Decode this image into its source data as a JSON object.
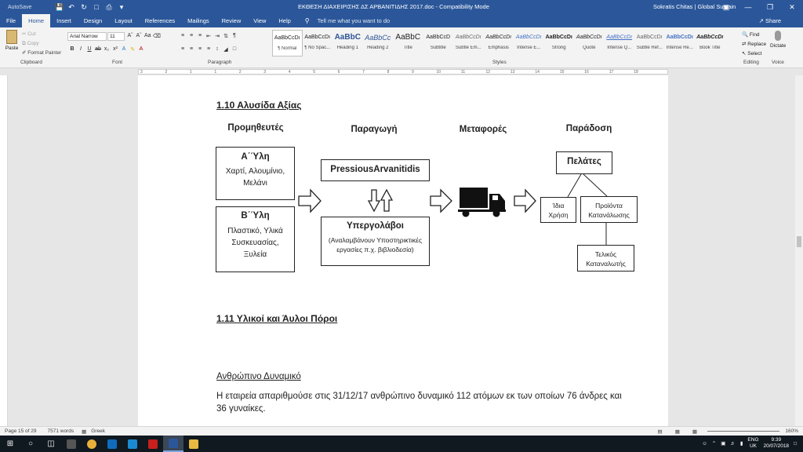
{
  "titlebar": {
    "autosave": "AutoSave",
    "doc_title": "ΕΚΘΕΣΗ ΔΙΑΧΕΙΡΙΣΗΣ ΔΣ ΑΡΒΑΝΙΤΙΔΗΣ 2017.doc  -  Compatibility Mode",
    "user": "Sokratis Chitas | Global Sustain",
    "share": "Share"
  },
  "tabs": [
    "File",
    "Home",
    "Insert",
    "Design",
    "Layout",
    "References",
    "Mailings",
    "Review",
    "View",
    "Help"
  ],
  "tellme": "Tell me what you want to do",
  "ribbon": {
    "paste": "Paste",
    "cut": "Cut",
    "copy": "Copy",
    "format_painter": "Format Painter",
    "clipboard": "Clipboard",
    "font_name": "Arial Narrow",
    "font_size": "11",
    "font": "Font",
    "paragraph": "Paragraph",
    "styles_label": "Styles",
    "editing_label": "Editing",
    "voice_label": "Voice",
    "find": "Find",
    "replace": "Replace",
    "select": "Select",
    "dictate": "Dictate",
    "styles": [
      {
        "sample": "AaBbCcDı",
        "name": "¶ Normal"
      },
      {
        "sample": "AaBbCcDı",
        "name": "¶ No Spac..."
      },
      {
        "sample": "AaBbC",
        "name": "Heading 1"
      },
      {
        "sample": "AaBbCc",
        "name": "Heading 2"
      },
      {
        "sample": "AaBbC",
        "name": "Title"
      },
      {
        "sample": "AaBbCcD",
        "name": "Subtitle"
      },
      {
        "sample": "AaBbCcDı",
        "name": "Subtle Em..."
      },
      {
        "sample": "AaBbCcDı",
        "name": "Emphasis"
      },
      {
        "sample": "AaBbCcDı",
        "name": "Intense E..."
      },
      {
        "sample": "AaBbCcDı",
        "name": "Strong"
      },
      {
        "sample": "AaBbCcDı",
        "name": "Quote"
      },
      {
        "sample": "AaBbCcDı",
        "name": "Intense Q..."
      },
      {
        "sample": "AaBbCcDı",
        "name": "Subtle Ref..."
      },
      {
        "sample": "AaBbCcDı",
        "name": "Intense Re..."
      },
      {
        "sample": "AaBbCcDı",
        "name": "Book Title"
      }
    ]
  },
  "ruler_ticks": [
    "3",
    "2",
    "1",
    "1",
    "2",
    "3",
    "4",
    "5",
    "6",
    "7",
    "8",
    "9",
    "10",
    "11",
    "12",
    "13",
    "14",
    "15",
    "16",
    "17",
    "18"
  ],
  "document": {
    "heading_1_10": "1.10 Αλυσίδα Αξίας",
    "col_suppliers": "Προμηθευτές",
    "col_production": "Παραγωγή",
    "col_transport": "Μεταφορές",
    "col_delivery": "Παράδοση",
    "box_a_title": "Α΄Ύλη",
    "box_a_line1": "Χαρτί, Αλουμίνιο,",
    "box_a_line2": "Μελάνι",
    "box_b_title": "Β΄Ύλη",
    "box_b_line1": "Πλαστικό, Υλικά",
    "box_b_line2": "Συσκευασίας,",
    "box_b_line3": "Ξυλεία",
    "box_pressious": "PressiousArvanitidis",
    "box_subcontractors_title": "Υπεργολάβοι",
    "box_subcontractors_line1": "(Αναλαμβάνουν Υποστηρικτικές",
    "box_subcontractors_line2": "εργασίες π.χ. βιβλιοδεσία)",
    "box_customers": "Πελάτες",
    "box_own_use_1": "Ίδια",
    "box_own_use_2": "Χρήση",
    "box_consumer_products_1": "Προϊόντα",
    "box_consumer_products_2": "Κατανάλωσης",
    "box_end_consumers_1": "Τελικός",
    "box_end_consumers_2": "Καταναλωτής",
    "heading_1_11": "1.11 Υλικοί και Άυλοι Πόροι",
    "human_resources": "Ανθρώπινο Δυναμικό",
    "paragraph_line1": "Η εταιρεία απαριθμούσε στις 31/12/17 ανθρώπινο δυναμικό 112 ατόμων εκ των οποίων 76 άνδρες και",
    "paragraph_line2": "36 γυναίκες."
  },
  "status": {
    "page": "Page 15 of 29",
    "words": "7571 words",
    "language": "Greek",
    "zoom": "160%"
  },
  "tray": {
    "lang_1": "ENG",
    "lang_2": "UK",
    "time": "9:39",
    "date": "20/07/2018"
  }
}
